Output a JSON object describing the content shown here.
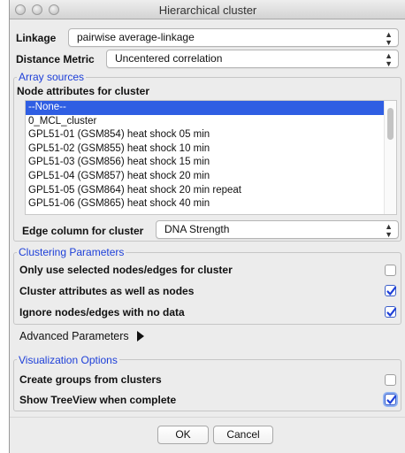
{
  "window": {
    "title": "Hierarchical cluster"
  },
  "linkage": {
    "label": "Linkage",
    "value": "pairwise average-linkage"
  },
  "distance_metric": {
    "label": "Distance Metric",
    "value": "Uncentered correlation"
  },
  "array_sources": {
    "title": "Array sources",
    "node_attributes_label": "Node attributes for cluster",
    "items": [
      "--None--",
      "0_MCL_cluster",
      "GPL51-01 (GSM854) heat shock 05 min",
      "GPL51-02 (GSM855) heat shock 10 min",
      "GPL51-03 (GSM856) heat shock 15 min",
      "GPL51-04 (GSM857) heat shock 20 min",
      "GPL51-05 (GSM864) heat shock 20 min repeat",
      "GPL51-06 (GSM865) heat shock 40 min"
    ],
    "selected_index": 0,
    "edge_column_label": "Edge column for cluster",
    "edge_column_value": "DNA Strength"
  },
  "clustering_parameters": {
    "title": "Clustering Parameters",
    "options": [
      {
        "label": "Only use selected nodes/edges for cluster",
        "checked": false
      },
      {
        "label": "Cluster attributes as well as nodes",
        "checked": true
      },
      {
        "label": "Ignore nodes/edges with no data",
        "checked": true
      }
    ]
  },
  "advanced_parameters": {
    "label": "Advanced Parameters"
  },
  "visualization_options": {
    "title": "Visualization Options",
    "options": [
      {
        "label": "Create groups from clusters",
        "checked": false
      },
      {
        "label": "Show TreeView when complete",
        "checked": true
      }
    ]
  },
  "buttons": {
    "ok": "OK",
    "cancel": "Cancel"
  },
  "colors": {
    "accent": "#2f5ee3",
    "group_title": "#1d3fd8",
    "window_bg": "#ececec"
  }
}
